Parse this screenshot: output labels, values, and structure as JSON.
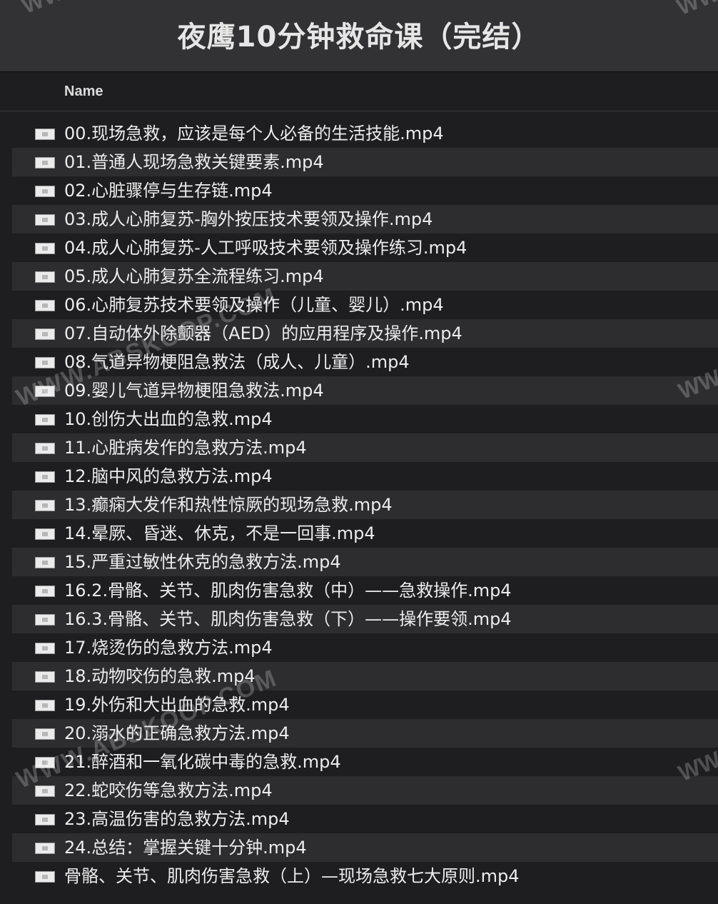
{
  "window": {
    "title": "夜鹰10分钟救命课（完结）"
  },
  "header": {
    "name_column": "Name"
  },
  "files": [
    "00.现场急救，应该是每个人必备的生活技能.mp4",
    "01.普通人现场急救关键要素.mp4",
    "02.心脏骤停与生存链.mp4",
    "03.成人心肺复苏-胸外按压技术要领及操作.mp4",
    "04.成人心肺复苏-人工呼吸技术要领及操作练习.mp4",
    "05.成人心肺复苏全流程练习.mp4",
    "06.心肺复苏技术要领及操作（儿童、婴儿）.mp4",
    "07.自动体外除颤器（AED）的应用程序及操作.mp4",
    "08.气道异物梗阻急救法（成人、儿童）.mp4",
    "09.婴儿气道异物梗阻急救法.mp4",
    "10.创伤大出血的急救.mp4",
    "11.心脏病发作的急救方法.mp4",
    "12.脑中风的急救方法.mp4",
    "13.癫痫大发作和热性惊厥的现场急救.mp4",
    "14.晕厥、昏迷、休克，不是一回事.mp4",
    "15.严重过敏性休克的急救方法.mp4",
    "16.2.骨骼、关节、肌肉伤害急救（中）——急救操作.mp4",
    "16.3.骨骼、关节、肌肉伤害急救（下）——操作要领.mp4",
    "17.烧烫伤的急救方法.mp4",
    "18.动物咬伤的急救.mp4",
    "19.外伤和大出血的急救.mp4",
    "20.溺水的正确急救方法.mp4",
    "21.醉酒和一氧化碳中毒的急救.mp4",
    "22.蛇咬伤等急救方法.mp4",
    "23.高温伤害的急救方法.mp4",
    "24.总结：掌握关键十分钟.mp4",
    "骨骼、关节、肌肉伤害急救（上）—现场急救七大原则.mp4"
  ],
  "watermarks": {
    "main": "WWW.ABSKOOP.COM",
    "edge": "WW"
  }
}
